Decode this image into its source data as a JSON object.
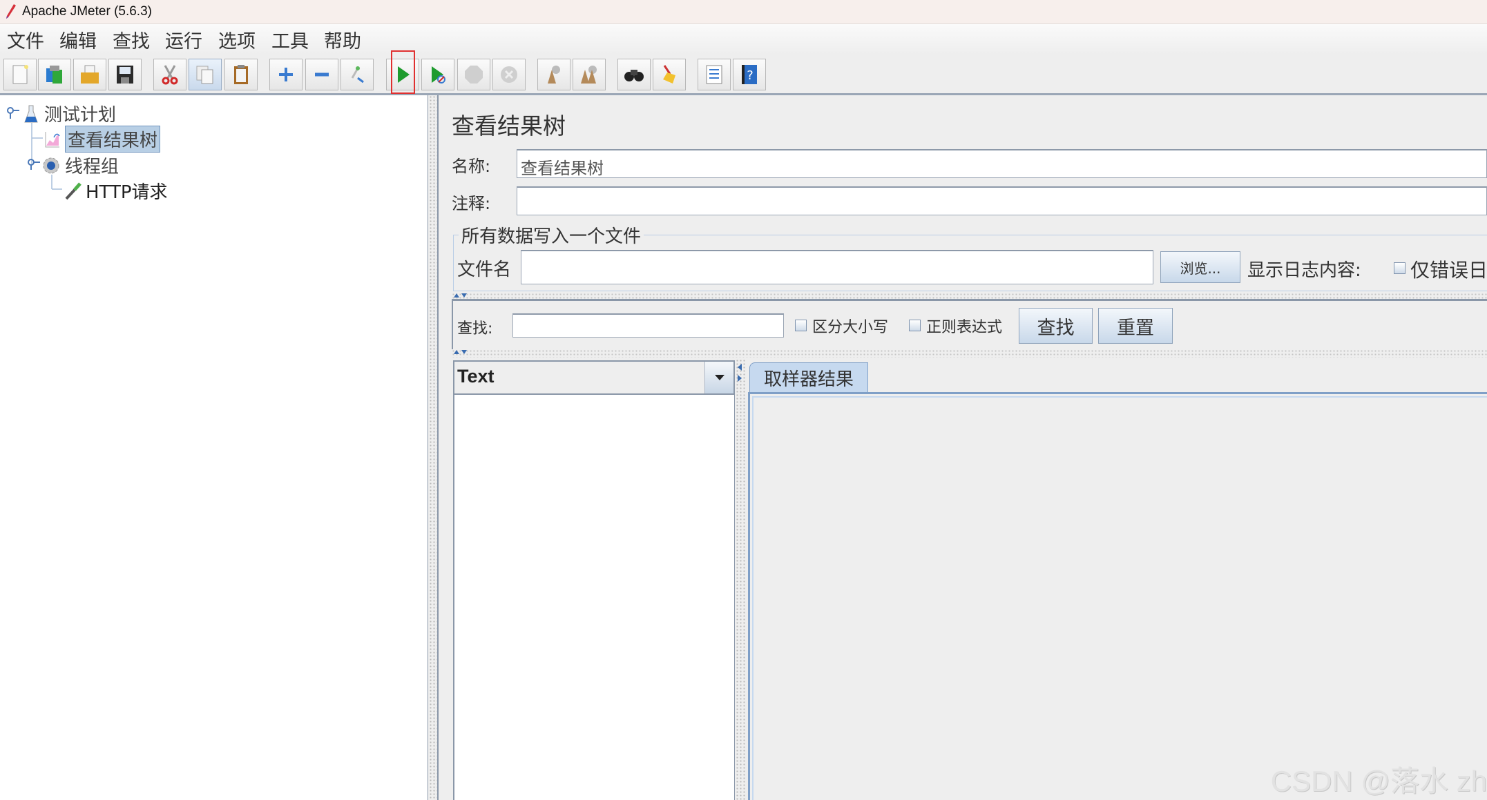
{
  "window": {
    "title": "Apache JMeter (5.6.3)"
  },
  "menu": [
    "文件",
    "编辑",
    "查找",
    "运行",
    "选项",
    "工具",
    "帮助"
  ],
  "toolbar": {
    "buttons": [
      {
        "name": "new-icon"
      },
      {
        "name": "templates-icon"
      },
      {
        "name": "open-icon"
      },
      {
        "name": "save-icon"
      },
      {
        "name": "cut-icon"
      },
      {
        "name": "copy-icon"
      },
      {
        "name": "paste-icon"
      },
      {
        "name": "expand-icon"
      },
      {
        "name": "collapse-icon"
      },
      {
        "name": "toggle-icon"
      },
      {
        "name": "start-icon"
      },
      {
        "name": "start-no-pause-icon"
      },
      {
        "name": "stop-icon"
      },
      {
        "name": "shutdown-icon"
      },
      {
        "name": "clear-icon"
      },
      {
        "name": "clear-all-icon"
      },
      {
        "name": "search-icon"
      },
      {
        "name": "reset-search-icon"
      },
      {
        "name": "function-helper-icon"
      },
      {
        "name": "help-icon"
      }
    ],
    "highlighted": "start-icon"
  },
  "tree": {
    "nodes": [
      {
        "label": "测试计划",
        "icon": "test-plan-icon",
        "level": 0,
        "expanded": true
      },
      {
        "label": "查看结果树",
        "icon": "listener-icon",
        "level": 1,
        "selected": true
      },
      {
        "label": "线程组",
        "icon": "thread-group-icon",
        "level": 1,
        "expanded": true
      },
      {
        "label": "HTTP请求",
        "icon": "sampler-icon",
        "level": 2
      }
    ]
  },
  "panel": {
    "title": "查看结果树",
    "name_label": "名称:",
    "name_value": "查看结果树",
    "comment_label": "注释:",
    "comment_value": "",
    "file_group": {
      "title": "所有数据写入一个文件",
      "filename_label": "文件名",
      "filename_value": "",
      "browse_label": "浏览...",
      "log_label": "显示日志内容:",
      "errors_only_label": "仅错误日",
      "errors_only_checked": false
    },
    "search": {
      "label": "查找:",
      "value": "",
      "case_label": "区分大小写",
      "case_checked": false,
      "regex_label": "正则表达式",
      "regex_checked": false,
      "find_label": "查找",
      "reset_label": "重置"
    },
    "renderer": {
      "selected": "Text"
    },
    "tabs": [
      {
        "label": "取样器结果",
        "active": true
      }
    ]
  },
  "watermark": "CSDN @落水 zh"
}
